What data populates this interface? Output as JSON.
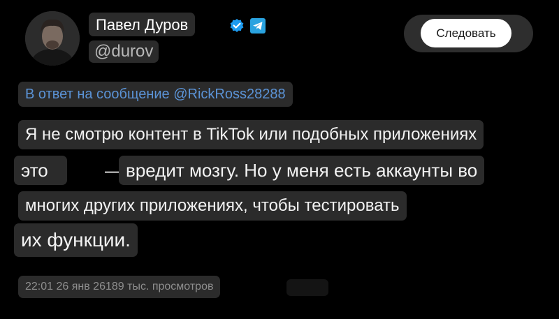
{
  "author": {
    "name": "Павел Дуров",
    "handle": "@durov",
    "avatar_icon": "profile-photo",
    "verified_icon": "verified-check-icon",
    "telegram_icon": "telegram-icon"
  },
  "actions": {
    "follow_label": "Следовать"
  },
  "reply": {
    "text": "В ответ на сообщение @RickRoss28288"
  },
  "body": {
    "line1": "Я не смотрю контент в TikTok или подобных приложениях",
    "line2_start": "это",
    "line2_dash": "—",
    "line2_end": "вредит мозгу. Но у меня есть аккаунты во",
    "line3": "многих других приложениях, чтобы тестировать",
    "line4": "их функции."
  },
  "meta": {
    "text": "22:01 26 янв 26189 тыс. просмотров"
  },
  "colors": {
    "background": "#000000",
    "chip": "#2b2b2b",
    "link": "#5b93d6",
    "verified": "#1d9bf0",
    "muted": "#8e8e8e"
  }
}
